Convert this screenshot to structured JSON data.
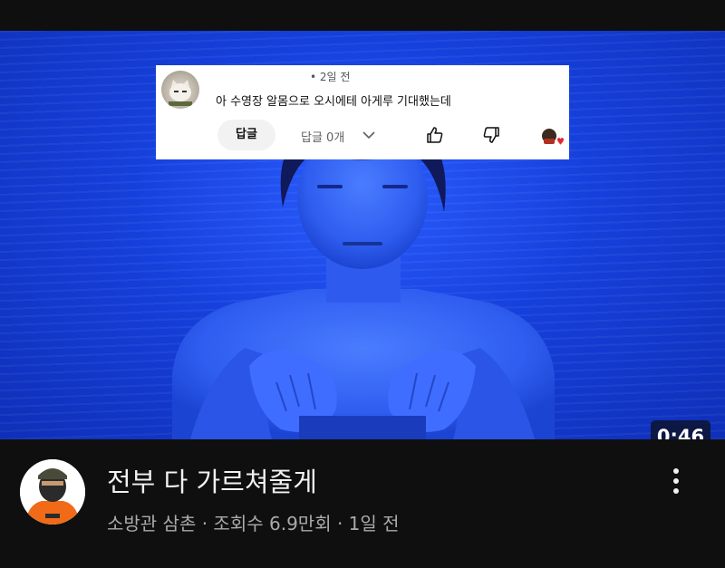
{
  "comment": {
    "time": "• 2일 전",
    "text": "아 수영장 알몸으로 오시에테 아게루 기대했는데",
    "reply_button": "답글",
    "reply_count": "답글 0개",
    "avatar_icon": "cat-avatar-icon",
    "like_icon": "thumb-up-icon",
    "dislike_icon": "thumb-down-icon",
    "creator_heart_icon": "creator-heart-icon"
  },
  "video": {
    "duration": "0:46",
    "title": "전부 다 가르쳐줄게",
    "meta": "소방관 삼촌 · 조회수 6.9만회 · 1일 전",
    "more_icon": "more-vert-icon"
  },
  "colors": {
    "background": "#0f0f0f",
    "thumbnail_blue": "#1640dc",
    "title_text": "#f1f1f1",
    "meta_text": "#aaaaaa"
  }
}
